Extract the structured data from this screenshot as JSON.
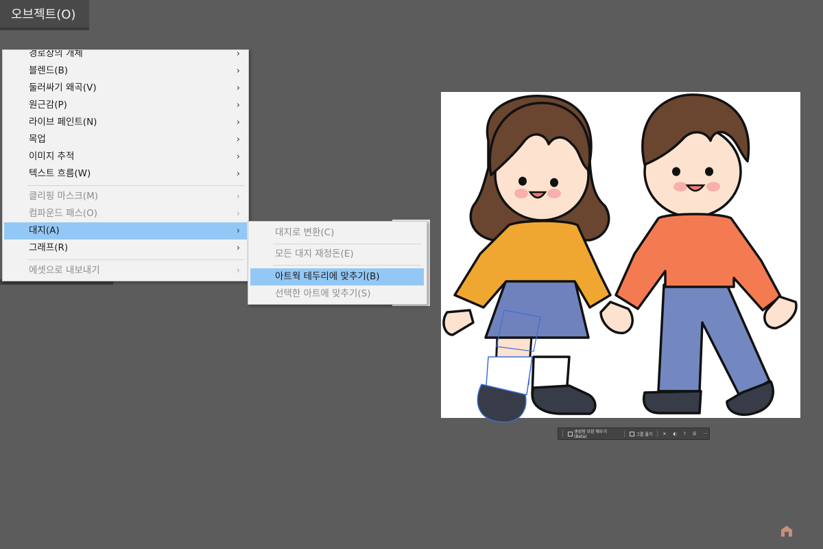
{
  "menubar": {
    "object_menu": "오브젝트(O)"
  },
  "menu": {
    "items": [
      {
        "label": "경로상의 개체",
        "arrow": "›"
      },
      {
        "label": "블렌드(B)",
        "arrow": "›"
      },
      {
        "label": "둘러싸기 왜곡(V)",
        "arrow": "›"
      },
      {
        "label": "원근감(P)",
        "arrow": "›"
      },
      {
        "label": "라이브 페인트(N)",
        "arrow": "›"
      },
      {
        "label": "목업",
        "arrow": "›"
      },
      {
        "label": "이미지 추적",
        "arrow": "›"
      },
      {
        "label": "텍스트 흐름(W)",
        "arrow": "›"
      },
      {
        "label": "클리핑 마스크(M)",
        "arrow": "›"
      },
      {
        "label": "컴파운드 패스(O)",
        "arrow": "›"
      },
      {
        "label": "대지(A)",
        "arrow": "›"
      },
      {
        "label": "그래프(R)",
        "arrow": "›"
      },
      {
        "label": "에셋으로 내보내기",
        "arrow": "›"
      }
    ]
  },
  "submenu": {
    "items": [
      {
        "label": "대지로 변환(C)"
      },
      {
        "label": "모든 대지 재정돈(E)"
      },
      {
        "label": "아트웍 테두리에 맞추기(B)"
      },
      {
        "label": "선택한 아트에 맞추기(S)"
      }
    ]
  },
  "taskbar": {
    "generate_fill": "생성형 모양 채우기(Beta)",
    "ungroup": "그룹 풀기",
    "more": "···"
  },
  "colors": {
    "background": "#5c5c5c",
    "menu_bg": "#f2f2f2",
    "highlight": "#93c8f6",
    "girl_top": "#f0a732",
    "girl_skirt": "#6f82bd",
    "boy_top": "#f47a52",
    "boy_pants": "#7388c0",
    "hair": "#6a4530",
    "skin": "#fde2cf",
    "shoe": "#383b48"
  }
}
